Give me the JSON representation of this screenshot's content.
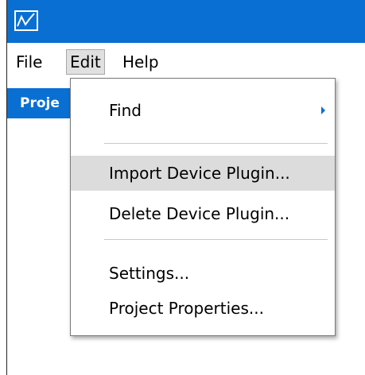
{
  "app": {
    "icon": "chart-line-icon",
    "accent_color": "#0a6fd2"
  },
  "menubar": {
    "items": [
      {
        "label": "File"
      },
      {
        "label": "Edit",
        "active": true
      },
      {
        "label": "Help"
      }
    ]
  },
  "sidebar": {
    "project_tab_label": "Proje"
  },
  "edit_menu": {
    "items": [
      {
        "label": "Find",
        "has_submenu": true,
        "submenu_icon": "chevron-right-icon"
      },
      {
        "label": "Import Device Plugin...",
        "highlighted": true
      },
      {
        "label": "Delete Device Plugin..."
      },
      {
        "label": "Settings..."
      },
      {
        "label": "Project Properties..."
      }
    ]
  }
}
